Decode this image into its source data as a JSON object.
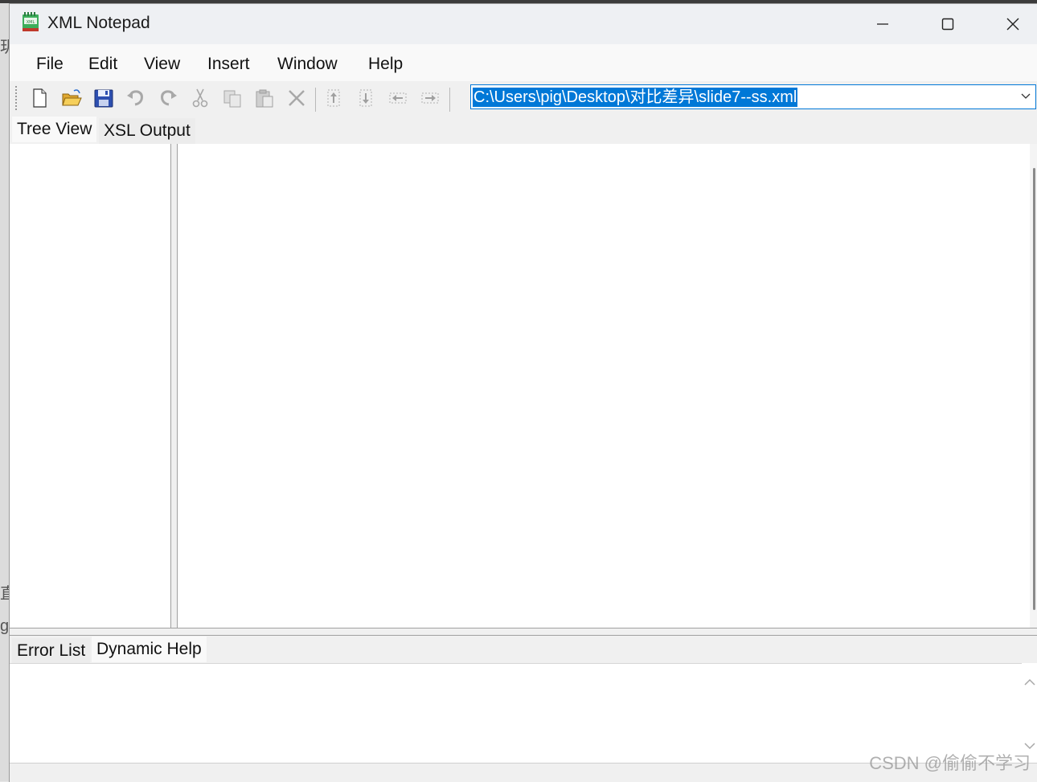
{
  "window": {
    "title": "XML Notepad",
    "app_icon": "xml-notepad-icon",
    "controls": [
      "minimize-icon",
      "maximize-icon",
      "close-icon"
    ]
  },
  "menu": {
    "items": [
      {
        "label": "File"
      },
      {
        "label": "Edit"
      },
      {
        "label": "View"
      },
      {
        "label": "Insert"
      },
      {
        "label": "Window"
      },
      {
        "label": "Help"
      }
    ]
  },
  "toolbar": {
    "buttons": [
      {
        "name": "new-file-icon",
        "enabled": true
      },
      {
        "name": "open-folder-icon",
        "enabled": true
      },
      {
        "name": "save-icon",
        "enabled": true
      },
      {
        "name": "undo-icon",
        "enabled": false
      },
      {
        "name": "redo-icon",
        "enabled": false
      },
      {
        "name": "cut-icon",
        "enabled": false
      },
      {
        "name": "copy-icon",
        "enabled": false
      },
      {
        "name": "paste-icon",
        "enabled": false
      },
      {
        "name": "delete-icon",
        "enabled": false
      },
      {
        "name": "nudge-up-icon",
        "enabled": false
      },
      {
        "name": "nudge-down-icon",
        "enabled": false
      },
      {
        "name": "nudge-left-icon",
        "enabled": false
      },
      {
        "name": "nudge-right-icon",
        "enabled": false
      }
    ],
    "address": "C:\\Users\\pig\\Desktop\\对比差异\\slide7--ss.xml"
  },
  "tabs": {
    "top": [
      {
        "label": "Tree View",
        "active": true
      },
      {
        "label": "XSL Output",
        "active": false
      }
    ],
    "bottom": [
      {
        "label": "Error List",
        "active": false
      },
      {
        "label": "Dynamic Help",
        "active": true
      }
    ]
  },
  "background": {
    "left_glyphs": [
      "玥",
      "直",
      "g"
    ]
  },
  "watermark": "CSDN @偷偷不学习",
  "colors": {
    "accent": "#0078d7",
    "window_bg": "#f0f0f0",
    "pane_bg": "#ffffff"
  }
}
